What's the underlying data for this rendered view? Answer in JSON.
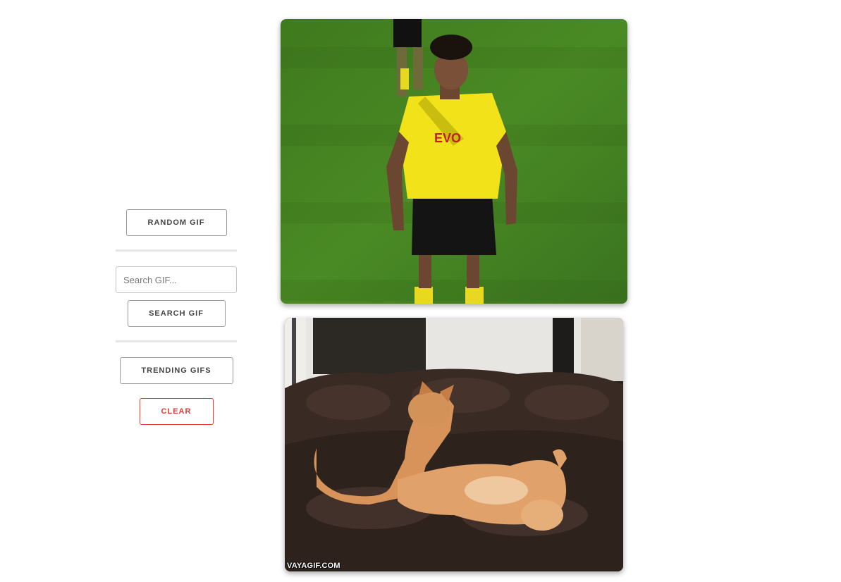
{
  "sidebar": {
    "random_button": "RANDOM GIF",
    "search_placeholder": "Search GIF...",
    "search_value": "",
    "search_button": "SEARCH GIF",
    "trending_button": "TRENDING GIFS",
    "clear_button": "CLEAR"
  },
  "gifs": [
    {
      "kind": "soccer-player-gif"
    },
    {
      "kind": "cats-playing-gif",
      "watermark": "VAYAGIF.COM"
    }
  ],
  "colors": {
    "clear_accent": "#e53935",
    "button_text": "#444444",
    "divider": "#e6e6e6"
  }
}
